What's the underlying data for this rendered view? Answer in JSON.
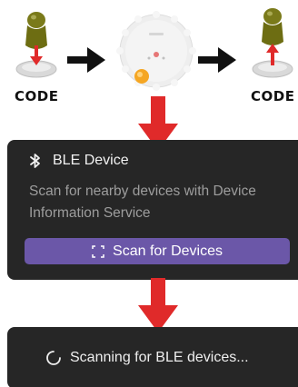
{
  "illustration": {
    "left_label": "CODE",
    "right_label": "CODE"
  },
  "ble_card": {
    "title": "BLE Device",
    "description": "Scan for nearby devices with Device Information Service",
    "scan_button_label": "Scan for Devices"
  },
  "scanning_card": {
    "status": "Scanning for BLE devices..."
  },
  "colors": {
    "card_bg": "#262626",
    "button_bg": "#6b57a8",
    "arrow_red": "#e02a2a",
    "arrow_black": "#111111"
  }
}
